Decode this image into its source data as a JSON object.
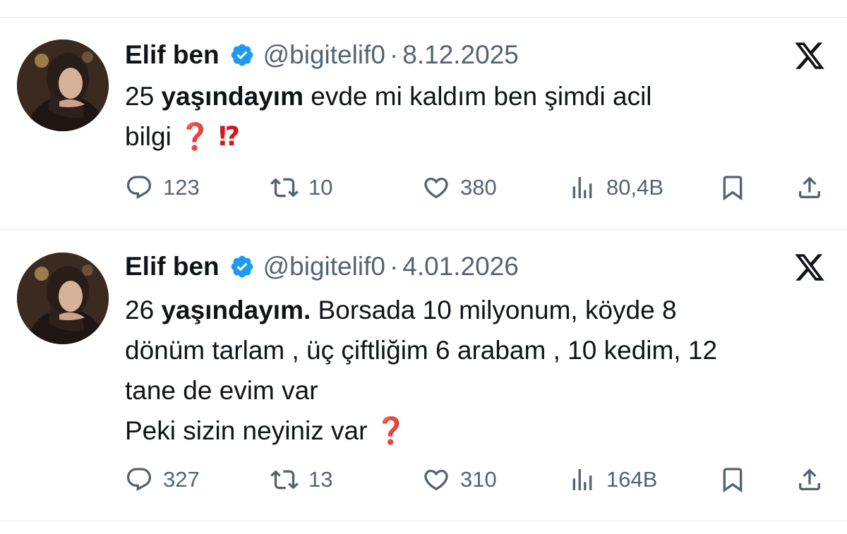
{
  "tweets": [
    {
      "name": "Elif ben",
      "handle": "@bigitelif0",
      "separator": "·",
      "date": "8.12.2025",
      "text_lines": [
        [
          {
            "t": "25 "
          },
          {
            "t": "yaşındayım",
            "bold": true
          },
          {
            "t": " evde mi kaldım ben şimdi acil"
          }
        ],
        [
          {
            "t": "bilgi "
          },
          {
            "t": "❓",
            "emoji": true
          },
          {
            "t": " "
          },
          {
            "t": "⁉",
            "emoji": true
          }
        ]
      ],
      "replies": "123",
      "reposts": "10",
      "likes": "380",
      "views": "80,4B"
    },
    {
      "name": "Elif ben",
      "handle": "@bigitelif0",
      "separator": "·",
      "date": "4.01.2026",
      "text_lines": [
        [
          {
            "t": "26 "
          },
          {
            "t": "yaşındayım.",
            "bold": true
          },
          {
            "t": " Borsada 10 milyonum, köyde 8"
          }
        ],
        [
          {
            "t": "dönüm tarlam , üç çiftliğim 6 arabam , 10 kedim, 12"
          }
        ],
        [
          {
            "t": "tane de evim var"
          }
        ],
        [
          {
            "t": "Peki sizin neyiniz var "
          },
          {
            "t": "❓",
            "emoji": true
          }
        ]
      ],
      "replies": "327",
      "reposts": "13",
      "likes": "310",
      "views": "164B"
    }
  ],
  "icons": {
    "verified": "verified-badge-icon",
    "x_logo": "x-logo-icon",
    "reply": "reply-icon",
    "repost": "repost-icon",
    "like": "heart-icon",
    "views": "views-chart-icon",
    "bookmark": "bookmark-icon",
    "share": "share-icon"
  },
  "colors": {
    "verified": "#1d9bf0",
    "text": "#0f1419",
    "muted": "#536471",
    "emoji_red": "#d9161d"
  }
}
